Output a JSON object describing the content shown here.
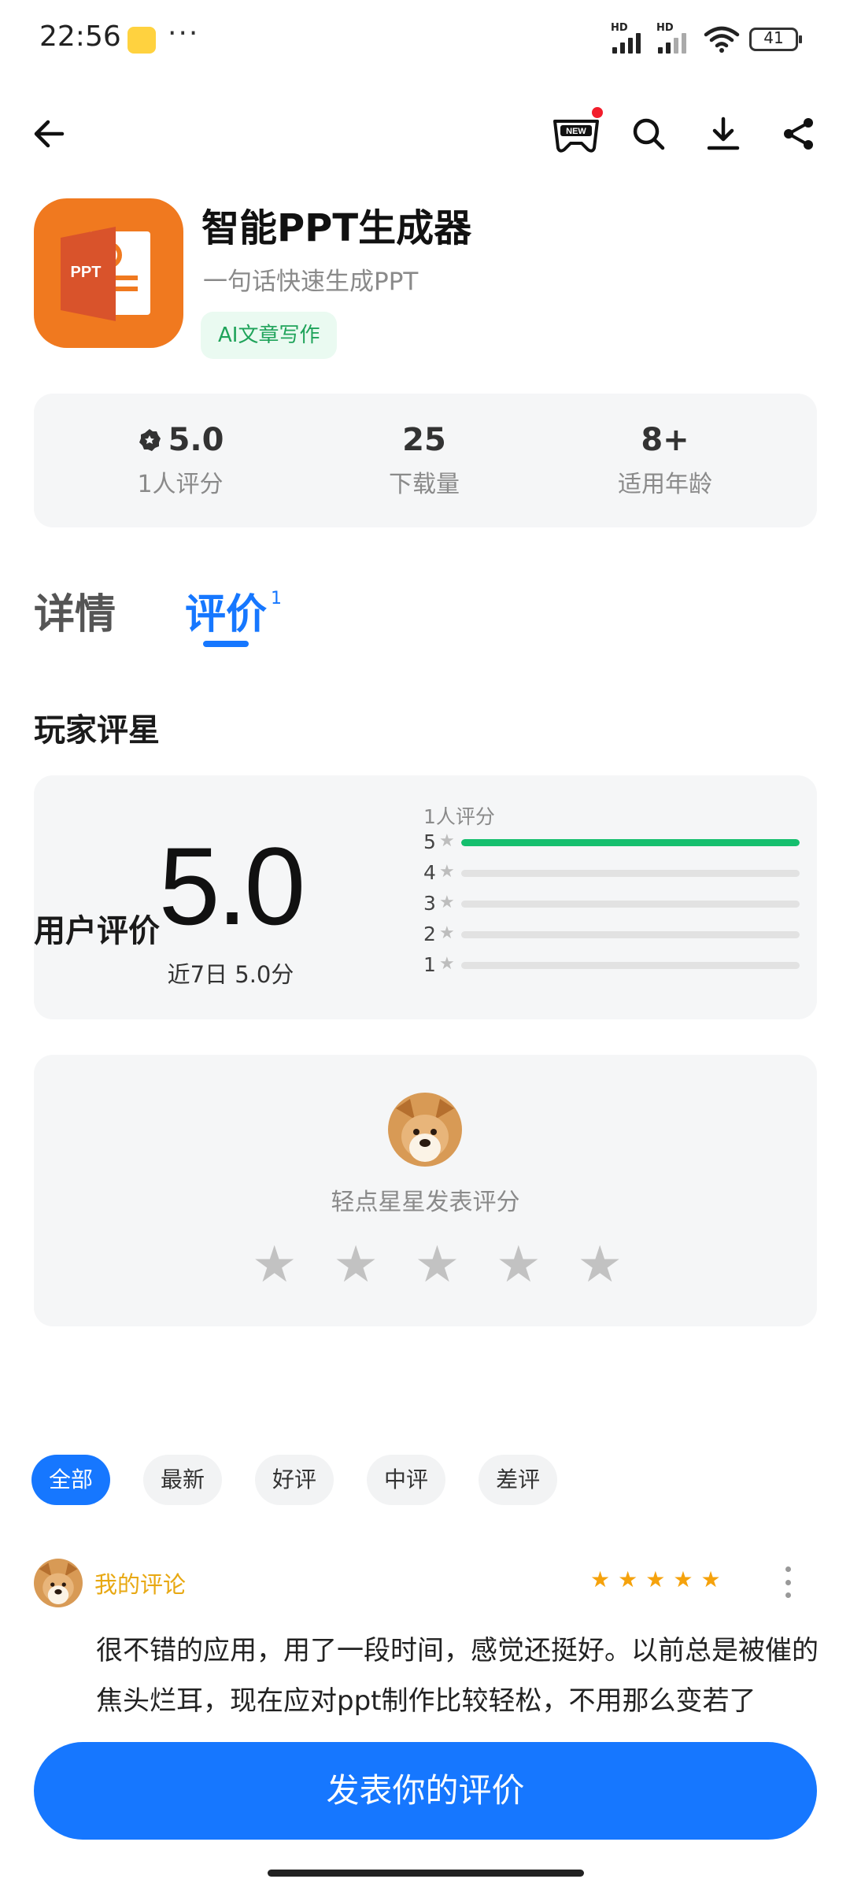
{
  "status_bar": {
    "time": "22:56",
    "dots": "···",
    "hd1": "HD",
    "hd2": "HD",
    "battery": "41"
  },
  "nav": {
    "back_icon": "arrow-left-icon",
    "game_icon": "new-gamepad-icon",
    "search_icon": "search-icon",
    "download_icon": "download-icon",
    "share_icon": "share-icon"
  },
  "app": {
    "name": "智能PPT生成器",
    "subtitle": "一句话快速生成PPT",
    "tag": "AI文章写作",
    "icon_text": "PPT",
    "brand_color": "#f0791f"
  },
  "stats": {
    "rating": "5.0",
    "rating_label": "1人评分",
    "downloads": "25",
    "downloads_label": "下载量",
    "age": "8+",
    "age_label": "适用年龄"
  },
  "tabs": {
    "details": "详情",
    "reviews": "评价",
    "reviews_count": "1"
  },
  "player_rating": {
    "title": "玩家评星",
    "score": "5.0",
    "recent": "近7日 5.0分",
    "count_label": "1人评分",
    "distribution": [
      {
        "star": "5",
        "fraction": 1.0
      },
      {
        "star": "4",
        "fraction": 0
      },
      {
        "star": "3",
        "fraction": 0
      },
      {
        "star": "2",
        "fraction": 0
      },
      {
        "star": "1",
        "fraction": 0
      }
    ]
  },
  "rate_prompt": {
    "hint": "轻点星星发表评分",
    "star_count": 5
  },
  "user_reviews": {
    "title": "用户评价",
    "filters": [
      "全部",
      "最新",
      "好评",
      "中评",
      "差评"
    ],
    "active_filter": 0
  },
  "review": {
    "author": "我的评论",
    "stars": 5,
    "text": "很不错的应用，用了一段时间，感觉还挺好。以前总是被催的焦头烂耳，现在应对ppt制作比较轻松，不用那么变若了"
  },
  "post_button": "发表你的评价",
  "colors": {
    "accent": "#1677ff",
    "green": "#15bf6e",
    "star_gold": "#f5a20c",
    "author_gold": "#e8a812"
  }
}
